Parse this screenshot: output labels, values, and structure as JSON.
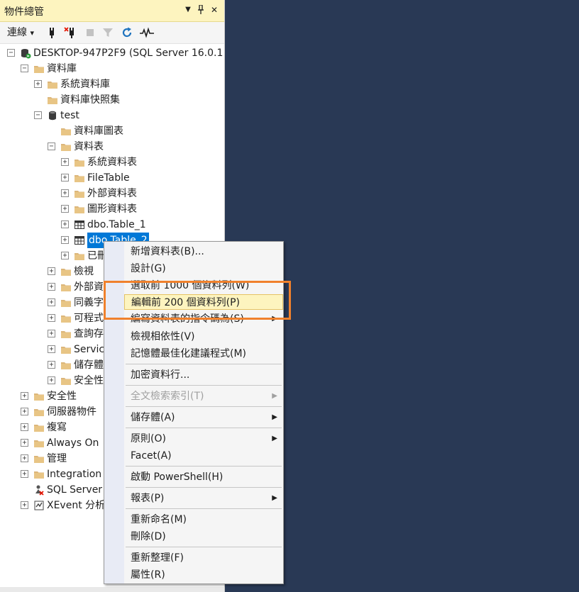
{
  "panel": {
    "title": "物件總管",
    "controls": {
      "dropdown": "▼",
      "pin": "📌",
      "close": "✕"
    }
  },
  "toolbar": {
    "connect_label": "連線",
    "connect_arrow": "▾"
  },
  "tree": [
    {
      "text": "DESKTOP-947P2F9 (SQL Server 16.0.1",
      "expander": "−",
      "icon": "server-icon"
    },
    {
      "text": "資料庫",
      "expander": "−",
      "icon": "folder-icon"
    },
    {
      "text": "系統資料庫",
      "expander": "+",
      "icon": "folder-icon"
    },
    {
      "text": "資料庫快照集",
      "expander": "",
      "icon": "folder-icon"
    },
    {
      "text": "test",
      "expander": "−",
      "icon": "database-icon"
    },
    {
      "text": "資料庫圖表",
      "expander": "",
      "icon": "folder-icon"
    },
    {
      "text": "資料表",
      "expander": "−",
      "icon": "folder-icon"
    },
    {
      "text": "系統資料表",
      "expander": "+",
      "icon": "folder-icon"
    },
    {
      "text": "FileTable",
      "expander": "+",
      "icon": "folder-icon"
    },
    {
      "text": "外部資料表",
      "expander": "+",
      "icon": "folder-icon"
    },
    {
      "text": "圖形資料表",
      "expander": "+",
      "icon": "folder-icon"
    },
    {
      "text": "dbo.Table_1",
      "expander": "+",
      "icon": "table-icon"
    },
    {
      "text": "dbo.Table_2",
      "expander": "+",
      "icon": "table-icon"
    },
    {
      "text": "已刪",
      "expander": "+",
      "icon": "folder-icon"
    },
    {
      "text": "檢視",
      "expander": "+",
      "icon": "folder-icon"
    },
    {
      "text": "外部資",
      "expander": "+",
      "icon": "folder-icon"
    },
    {
      "text": "同義字",
      "expander": "+",
      "icon": "folder-icon"
    },
    {
      "text": "可程式",
      "expander": "+",
      "icon": "folder-icon"
    },
    {
      "text": "查詢存",
      "expander": "+",
      "icon": "folder-icon"
    },
    {
      "text": "Servic",
      "expander": "+",
      "icon": "folder-icon"
    },
    {
      "text": "儲存體",
      "expander": "+",
      "icon": "folder-icon"
    },
    {
      "text": "安全性",
      "expander": "+",
      "icon": "folder-icon"
    },
    {
      "text": "安全性",
      "expander": "+",
      "icon": "folder-icon"
    },
    {
      "text": "伺服器物件",
      "expander": "+",
      "icon": "folder-icon"
    },
    {
      "text": "複寫",
      "expander": "+",
      "icon": "folder-icon"
    },
    {
      "text": "Always On",
      "expander": "+",
      "icon": "folder-icon"
    },
    {
      "text": "管理",
      "expander": "+",
      "icon": "folder-icon"
    },
    {
      "text": "Integration",
      "expander": "+",
      "icon": "folder-icon"
    },
    {
      "text": "SQL Server",
      "expander": "",
      "icon": "agent-icon"
    },
    {
      "text": "XEvent 分析",
      "expander": "+",
      "icon": "xevent-icon"
    }
  ],
  "context_menu": [
    {
      "label": "新增資料表(B)..."
    },
    {
      "label": "設計(G)"
    },
    {
      "label": "選取前 1000 個資料列(W)"
    },
    {
      "label": "編輯前 200 個資料列(P)",
      "highlighted": true
    },
    {
      "label": "編寫資料表的指令碼為(S)",
      "submenu": true
    },
    {
      "label": "檢視相依性(V)"
    },
    {
      "label": "記憶體最佳化建議程式(M)"
    },
    {
      "label": "加密資料行..."
    },
    {
      "label": "全文檢索索引(T)",
      "submenu": true,
      "disabled": true
    },
    {
      "label": "儲存體(A)",
      "submenu": true
    },
    {
      "label": "原則(O)",
      "submenu": true
    },
    {
      "label": "Facet(A)"
    },
    {
      "label": "啟動 PowerShell(H)"
    },
    {
      "label": "報表(P)",
      "submenu": true
    },
    {
      "label": "重新命名(M)"
    },
    {
      "label": "刪除(D)"
    },
    {
      "label": "重新整理(F)"
    },
    {
      "label": "屬性(R)"
    }
  ],
  "colors": {
    "background": "#293955",
    "selection": "#0078d7",
    "highlight": "#fdf4bf",
    "callout": "#f0812c"
  }
}
